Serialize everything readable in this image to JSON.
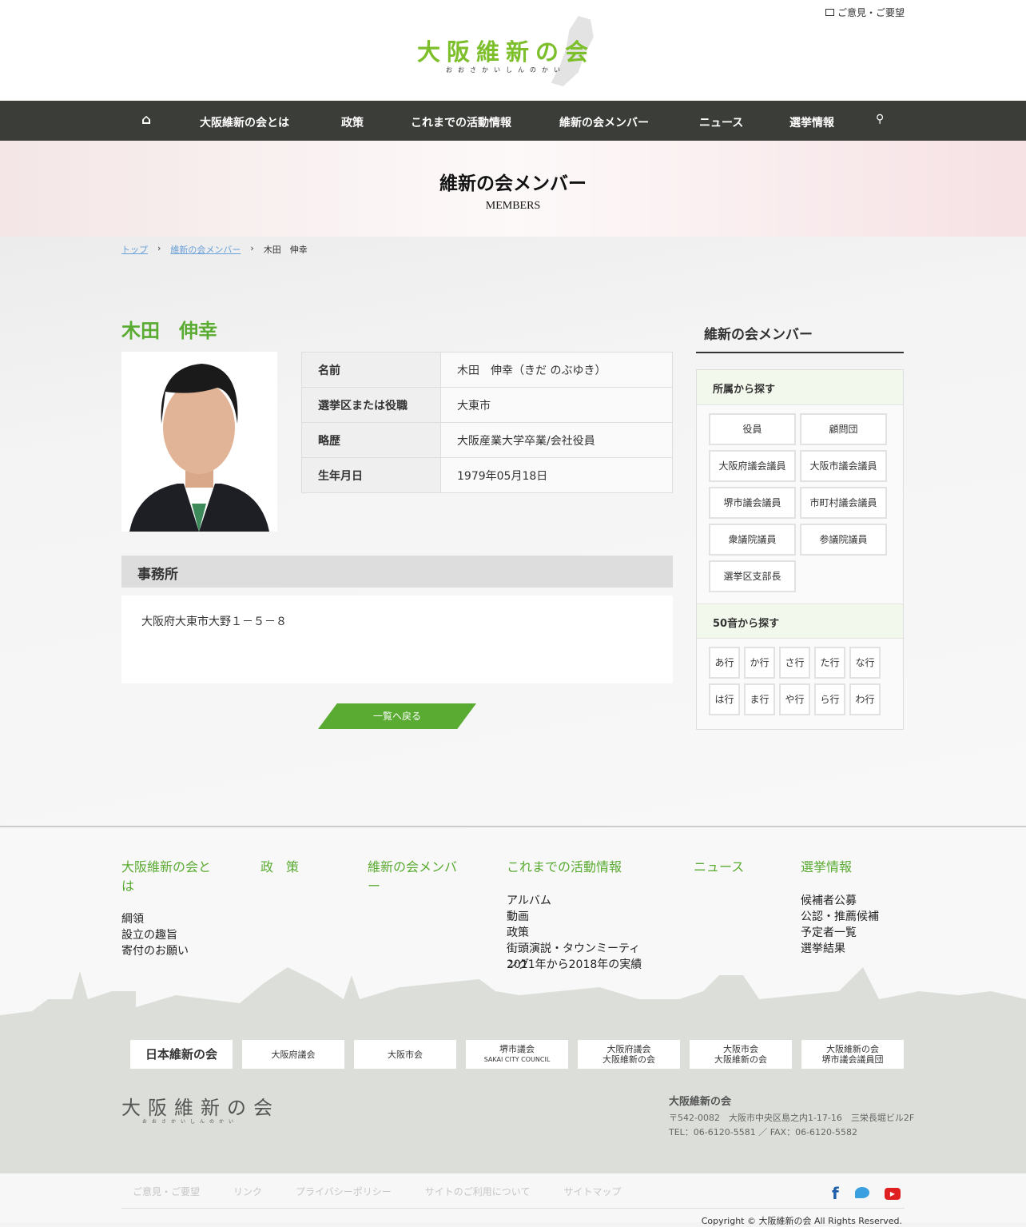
{
  "header": {
    "feedback": "ご意見・ご要望",
    "logo_text": "大阪維新の会",
    "logo_sub": "おおさかいしんのかい"
  },
  "nav": {
    "items": [
      "大阪維新の会とは",
      "政策",
      "これまでの活動情報",
      "維新の会メンバー",
      "ニュース",
      "選挙情報"
    ]
  },
  "hero": {
    "title": "維新の会メンバー",
    "subtitle": "MEMBERS"
  },
  "breadcrumb": [
    "トップ",
    "維新の会メンバー",
    "木田　伸幸"
  ],
  "member": {
    "name": "木田　伸幸",
    "rows": [
      {
        "label": "名前",
        "value": "木田　伸幸（きだ のぶゆき）"
      },
      {
        "label": "選挙区または役職",
        "value": "大東市"
      },
      {
        "label": "略歴",
        "value": "大阪産業大学卒業/会社役員"
      },
      {
        "label": "生年月日",
        "value": "1979年05月18日"
      }
    ],
    "office_title": "事務所",
    "office_address": "大阪府大東市大野１－５－８",
    "back": "一覧へ戻る"
  },
  "sidebar": {
    "title": "維新の会メンバー",
    "by_group": "所属から探す",
    "groups": [
      "役員",
      "顧問団",
      "大阪府議会議員",
      "大阪市議会議員",
      "堺市議会議員",
      "市町村議会議員",
      "衆議院議員",
      "参議院議員",
      "選挙区支部長"
    ],
    "by_kana": "50音から探す",
    "kana": [
      "あ行",
      "か行",
      "さ行",
      "た行",
      "な行",
      "は行",
      "ま行",
      "や行",
      "ら行",
      "わ行"
    ]
  },
  "footer": {
    "cols": [
      {
        "title": "大阪維新の会とは",
        "links": [
          "綱領",
          "設立の趣旨",
          "寄付のお願い"
        ]
      },
      {
        "title": "政　策",
        "links": []
      },
      {
        "title": "維新の会メンバー",
        "links": []
      },
      {
        "title": "これまでの活動情報",
        "links": [
          "アルバム",
          "動画",
          "政策",
          "街頭演説・タウンミーティング",
          "2011年から2018年の実績"
        ]
      },
      {
        "title": "ニュース",
        "links": []
      },
      {
        "title": "選挙情報",
        "links": [
          "候補者公募",
          "公認・推薦候補",
          "予定者一覧",
          "選挙結果"
        ]
      }
    ],
    "banners": [
      [
        "日本維新の会"
      ],
      [
        "大阪府議会"
      ],
      [
        "大阪市会"
      ],
      [
        "堺市議会",
        "SAKAI CITY COUNCIL"
      ],
      [
        "大阪府議会",
        "大阪維新の会"
      ],
      [
        "大阪市会",
        "大阪維新の会"
      ],
      [
        "大阪維新の会",
        "堺市議会議員団"
      ]
    ],
    "org": "大阪維新の会",
    "address": "〒542-0082　大阪市中央区島之内1-17-16　三栄長堀ビル2F",
    "tel": "TEL：06-6120-5581 ／ FAX：06-6120-5582",
    "bottom_links": [
      "ご意見・ご要望",
      "リンク",
      "プライバシーポリシー",
      "サイトのご利用について",
      "サイトマップ"
    ],
    "copyright": "Copyright © 大阪維新の会 All Rights Reserved."
  }
}
